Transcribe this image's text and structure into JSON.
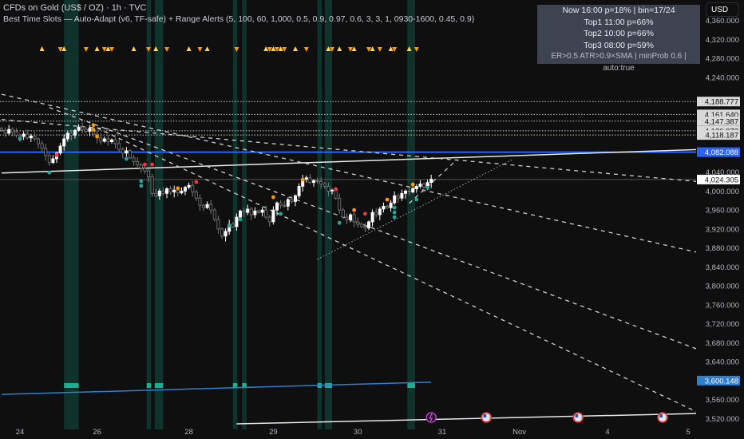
{
  "header": {
    "symbol_line": "CFDs on Gold (US$ / OZ) · 1h · TVC",
    "indicator_line": "Best Time Slots — Auto-Adapt (v6, TF-safe) + Range Alerts (5, 100, 60, 1,000, 0.5, 0.9, 0.97, 0.6, 3, 3, 1, 0930-1600, 0.45, 0.9)"
  },
  "infobox": {
    "lines": [
      "Now 16:00  p=18%  | bin=17/24",
      "Top1 11:00  p=66%",
      "Top2 10:00  p=66%",
      "Top3 08:00  p=59%"
    ],
    "footer": "ER>0.5  ATR>0.9×SMA  |  minProb 0.6  |  auto:true"
  },
  "currency": "USD",
  "colors": {
    "background": "#0f0f0f",
    "up_candle": "#ffffff",
    "down_candle": "#7a7a7a",
    "band": "#0f3a30",
    "band_block": "#1fae8f",
    "blue_line": "#2962ff",
    "bottom_blue": "#2f7fd1",
    "dot_green": "#26a69a",
    "dot_red": "#f23645",
    "dot_orange": "#ff9800",
    "tri_up": "#ffd54f",
    "tri_down": "#ff9800"
  },
  "chart_data": {
    "type": "candlestick",
    "title": "",
    "ylim": [
      3500,
      4380
    ],
    "y_ticks": [
      "4,360.000",
      "4,320.000",
      "4,280.000",
      "4,240.000",
      "4,040.000",
      "4,000.000",
      "3,960.000",
      "3,920.000",
      "3,880.000",
      "3,840.000",
      "3,800.000",
      "3,760.000",
      "3,720.000",
      "3,680.000",
      "3,640.000",
      "3,560.000",
      "3,520.000"
    ],
    "y_tick_values": [
      4360,
      4320,
      4280,
      4240,
      4040,
      4000,
      3960,
      3920,
      3880,
      3840,
      3800,
      3760,
      3720,
      3680,
      3640,
      3560,
      3520
    ],
    "x_ticks": [
      {
        "label": "24",
        "bar": 5
      },
      {
        "label": "26",
        "bar": 26
      },
      {
        "label": "28",
        "bar": 51
      },
      {
        "label": "29",
        "bar": 74
      },
      {
        "label": "30",
        "bar": 97
      },
      {
        "label": "31",
        "bar": 120
      },
      {
        "label": "Nov",
        "bar": 141
      },
      {
        "label": "4",
        "bar": 165
      },
      {
        "label": "5",
        "bar": 187
      }
    ],
    "closes": [
      4128,
      4122,
      4130,
      4125,
      4118,
      4115,
      4120,
      4112,
      4116,
      4110,
      4100,
      4090,
      4075,
      4060,
      4068,
      4080,
      4095,
      4110,
      4122,
      4118,
      4128,
      4135,
      4130,
      4126,
      4132,
      4120,
      4112,
      4105,
      4110,
      4104,
      4108,
      4100,
      4088,
      4080,
      4085,
      4070,
      4062,
      4055,
      4048,
      4042,
      4030,
      3995,
      3990,
      4000,
      3995,
      4005,
      3998,
      4002,
      3996,
      4000,
      4008,
      4012,
      3998,
      3985,
      3970,
      3965,
      3972,
      3960,
      3940,
      3920,
      3905,
      3915,
      3930,
      3925,
      3945,
      3958,
      3955,
      3962,
      3950,
      3958,
      3955,
      3960,
      3945,
      3935,
      3960,
      3975,
      3970,
      3968,
      3982,
      3978,
      3990,
      4010,
      4025,
      4028,
      4018,
      4022,
      4020,
      4015,
      4010,
      4000,
      4002,
      3985,
      3960,
      3945,
      3940,
      3950,
      3935,
      3930,
      3925,
      3922,
      3935,
      3955,
      3950,
      3962,
      3968,
      3965,
      3975,
      3990,
      3985,
      3995,
      4000,
      3998,
      4005,
      4010,
      4015,
      4008,
      4018,
      4025
    ],
    "price_labels": [
      {
        "value": 4188.777,
        "label": "4,188.777",
        "style": "dotted"
      },
      {
        "value": 4161.64,
        "label": "4,161.640",
        "style": "dotted"
      },
      {
        "value": 4147.387,
        "label": "4,147.387",
        "style": "dotted"
      },
      {
        "value": 4126.973,
        "label": "4,126.973",
        "style": "dotted"
      },
      {
        "value": 4118.187,
        "label": "4,118.187",
        "style": "dotted"
      },
      {
        "value": 4082.088,
        "label": "4,082.088",
        "style": "blue"
      },
      {
        "value": 4024.305,
        "label": "4,024.305",
        "style": "last"
      },
      {
        "value": 3600.148,
        "label": "3,600.148",
        "style": "bluebottom"
      }
    ],
    "bands": [
      [
        17,
        21
      ],
      [
        39.5,
        40.7
      ],
      [
        41.7,
        44
      ],
      [
        63,
        64.2
      ],
      [
        65.5,
        66.7
      ],
      [
        86,
        87.2
      ],
      [
        88,
        90
      ],
      [
        110.5,
        112.6
      ]
    ],
    "trend_lines": [
      {
        "kind": "solid-white",
        "from": [
          0,
          4038
        ],
        "to": [
          191,
          4088
        ]
      },
      {
        "kind": "dashed",
        "from": [
          0,
          4204
        ],
        "to": [
          191,
          3868
        ]
      },
      {
        "kind": "dashed",
        "from": [
          0,
          4151
        ],
        "to": [
          191,
          4019
        ]
      },
      {
        "kind": "dashed",
        "from": [
          13,
          4176
        ],
        "to": [
          191,
          3662
        ]
      },
      {
        "kind": "dashed",
        "from": [
          26,
          4133
        ],
        "to": [
          191,
          3528
        ]
      },
      {
        "kind": "dashed",
        "from": [
          111,
          3974
        ],
        "to": [
          124,
          4066
        ]
      },
      {
        "kind": "dotted",
        "from": [
          86,
          3856
        ],
        "to": [
          139,
          4066
        ]
      },
      {
        "kind": "solid-blue",
        "from": [
          0,
          3571
        ],
        "to": [
          117,
          3597
        ]
      },
      {
        "kind": "solid-white",
        "from": [
          64,
          3509
        ],
        "to": [
          191,
          3531
        ]
      }
    ],
    "dots": [
      {
        "bar": 5,
        "price": 4110,
        "kind": "green"
      },
      {
        "bar": 13,
        "price": 4039,
        "kind": "green"
      },
      {
        "bar": 34,
        "price": 4068,
        "kind": "green"
      },
      {
        "bar": 38,
        "price": 4021,
        "kind": "green"
      },
      {
        "bar": 38,
        "price": 4011,
        "kind": "green"
      },
      {
        "bar": 15,
        "price": 4076,
        "kind": "red"
      },
      {
        "bar": 39,
        "price": 4056,
        "kind": "red"
      },
      {
        "bar": 41,
        "price": 4056,
        "kind": "red"
      },
      {
        "bar": 53,
        "price": 4019,
        "kind": "red"
      },
      {
        "bar": 25,
        "price": 4139,
        "kind": "orange"
      },
      {
        "bar": 25,
        "price": 4129,
        "kind": "orange"
      },
      {
        "bar": 26,
        "price": 4115,
        "kind": "orange"
      },
      {
        "bar": 48,
        "price": 4006,
        "kind": "orange"
      },
      {
        "bar": 82,
        "price": 4024,
        "kind": "orange"
      },
      {
        "bar": 74,
        "price": 3987,
        "kind": "orange"
      },
      {
        "bar": 96,
        "price": 3960,
        "kind": "orange"
      },
      {
        "bar": 105,
        "price": 3982,
        "kind": "orange"
      },
      {
        "bar": 112,
        "price": 4014,
        "kind": "orange"
      },
      {
        "bar": 91,
        "price": 4004,
        "kind": "red"
      },
      {
        "bar": 99,
        "price": 3952,
        "kind": "red"
      },
      {
        "bar": 65,
        "price": 3940,
        "kind": "green"
      },
      {
        "bar": 62,
        "price": 3927,
        "kind": "green"
      },
      {
        "bar": 76,
        "price": 3952,
        "kind": "green"
      },
      {
        "bar": 92,
        "price": 3933,
        "kind": "green"
      },
      {
        "bar": 107,
        "price": 3965,
        "kind": "green"
      },
      {
        "bar": 107,
        "price": 3955,
        "kind": "green"
      },
      {
        "bar": 107,
        "price": 3945,
        "kind": "green"
      },
      {
        "bar": 113,
        "price": 3982,
        "kind": "green"
      },
      {
        "bar": 116,
        "price": 4007,
        "kind": "green"
      }
    ],
    "markers_up": [
      11,
      17,
      26,
      29,
      36,
      42,
      51,
      56,
      72,
      74,
      76,
      80,
      89,
      92,
      96,
      101,
      106,
      111
    ],
    "markers_down": [
      16,
      23,
      28,
      30,
      40,
      45,
      54,
      64,
      73,
      75,
      77,
      83,
      90,
      95,
      100,
      103,
      107,
      113
    ],
    "events": [
      {
        "bar": 117,
        "icon": "lightning-icon"
      },
      {
        "bar": 132,
        "icon": "us-flag-icon"
      },
      {
        "bar": 157,
        "icon": "us-flag-icon"
      },
      {
        "bar": 180,
        "icon": "us-flag-icon"
      }
    ]
  }
}
